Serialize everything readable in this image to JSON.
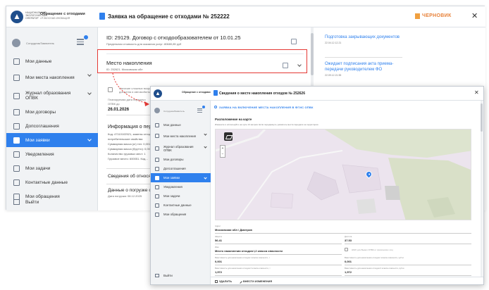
{
  "back": {
    "org_title": "Обращение с отходами",
    "org_line1": "НАЦИОНАЛЬНАЯ",
    "org_line2": "ЭКОЛОГИЧЕСКАЯ",
    "org_line3": "ОПЕРАТОР",
    "org_sub": "г.Р.ЭКОСНАБ ИНОВАЦИЯ",
    "user_name": "Сотрудник/Заявитель",
    "header_title": "Заявка на обращение с отходами № 252222",
    "draft_label": "ЧЕРНОВИК",
    "close_label": "✕",
    "menu": [
      {
        "label": "Мои данные",
        "chevron": false
      },
      {
        "label": "Мои места накопления",
        "chevron": true
      },
      {
        "label": "Журнал образования ОПВК",
        "chevron": true
      },
      {
        "label": "Мои договоры",
        "chevron": false
      },
      {
        "label": "Допсоглашения",
        "chevron": false
      },
      {
        "label": "Мои заявки",
        "chevron": true
      },
      {
        "label": "Уведомления",
        "chevron": false
      },
      {
        "label": "Мои задачи",
        "chevron": false
      },
      {
        "label": "Контактные данные",
        "chevron": false
      },
      {
        "label": "Мои обращения",
        "chevron": false
      }
    ],
    "exit_label": "Выйти",
    "contract_title": "ID: 29129. Договор с отходообразователем от 10.01.25",
    "contract_sub": "Предельная стоимость для оказания услуг: 80680,85 руб",
    "location_title": "Место накопления",
    "location_sub": "ID: 252621. Московская обл",
    "obscured_1": "Наличие сложных возражений за МНО доступна и автомобильного транспорта",
    "obscured_2": "Планируемая дата передачи",
    "obscured_3": "ОПВК до",
    "obscured_date": "26.01.2026",
    "transfer_title": "Информация о передаче",
    "transfer_lines": [
      "Код: 47110102521, замены отходов",
      "потребительские свойства",
      "Суммарная масса (кг) тел: 0,001",
      "Суммарная масса (брутто): 0,001",
      "Количество грузовых мест: 1",
      "Грузовое место: 600051. Код..."
    ],
    "transfer_extra": "Сведения об относящ...",
    "loading_title": "Данные о погрузке отх...",
    "loading_sub": "Дата погрузки: 08.12.2025",
    "notifications": [
      {
        "title": "Подготовка закрывающих документов",
        "date": "22.04.12.12.21"
      },
      {
        "title": "Ожидает подписания акта приема-передачи руководителем ФО",
        "date": "22.09.12.21.55"
      }
    ]
  },
  "front": {
    "org_title": "Обращение с отходами",
    "user_name": "Сотрудник/Заявитель",
    "header_title": "Сведения о месте накопления отходов № 252626",
    "close_label": "✕",
    "menu": [
      {
        "label": "Мои данные",
        "chevron": false
      },
      {
        "label": "Мои места накопления",
        "chevron": true
      },
      {
        "label": "Журнал образования ОПВК",
        "chevron": true
      },
      {
        "label": "Мои договоры",
        "chevron": false
      },
      {
        "label": "Допсоглашения",
        "chevron": false
      },
      {
        "label": "Мои заявки",
        "chevron": true
      },
      {
        "label": "Уведомления",
        "chevron": false
      },
      {
        "label": "Мои задачи",
        "chevron": false
      },
      {
        "label": "Контактные данные",
        "chevron": false
      },
      {
        "label": "Мои обращения",
        "chevron": false
      }
    ],
    "exit_label": "Выйти",
    "link_label": "ЗАЯВКА НА ВКЛЮЧЕНИЕ МЕСТА НАКОПЛЕНИЯ В ФГИС ОПВК",
    "section_title": "Расположение на карте",
    "map_hint": "Измените и используйте на лупе 13 метров. Если передвинуть указатель места передачи на территории.",
    "zoom_plus": "+",
    "zoom_minus": "−",
    "fields": {
      "address_label": "Адрес",
      "address_value": "Московская обл / Дмитров",
      "lat_label": "Широта",
      "lat_value": "56.41",
      "lon_label": "Долгота",
      "lon_value": "37.53",
      "name_label": "Имя",
      "name_value": "Место накопления отходов I,2 класса опасности",
      "checkbox_label": "НМО для Вывоз ОПВК от физических лиц",
      "q1_label": "Вместимость для накопления отходов I класса опасности, т",
      "q1_value": "0,001",
      "q2_label": "Вместимость для накопления отходов I класса опасности, куб.м",
      "q2_value": "0,001",
      "q3_label": "Вместимость для накопления отходов II класса опасности, т",
      "q3_value": "1,972",
      "q4_label": "Вместимость для накопления отходов II класса опасности, куб.м",
      "q4_value": "1,972",
      "own_label": "Сведения о собственности на место накопления",
      "own_value": "Собственность"
    },
    "delete_label": "УДАЛИТЬ",
    "edit_label": "ВНЕСТИ ИЗМЕНЕНИЯ"
  },
  "colors": {
    "accent": "#2f80ed",
    "draft": "#e8823a",
    "highlight": "#e53935",
    "map_bg": "#ece4ee"
  }
}
